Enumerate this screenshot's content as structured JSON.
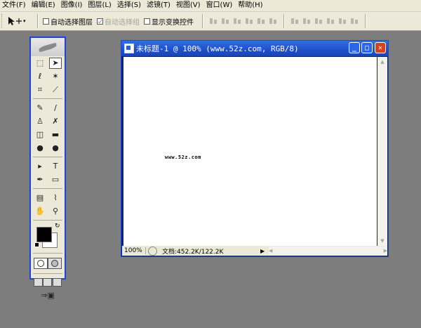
{
  "menu": [
    "文件(F)",
    "编辑(E)",
    "图像(I)",
    "图层(L)",
    "选择(S)",
    "滤镜(T)",
    "视图(V)",
    "窗口(W)",
    "帮助(H)"
  ],
  "options": {
    "auto_select_layer": "自动选择图层",
    "auto_select_group": "自动选择组",
    "show_transform_controls": "显示变换控件"
  },
  "document": {
    "title": "未标题-1 @ 100% (www.52z.com, RGB/8)",
    "canvas_text": "www.52z.com",
    "zoom": "100%",
    "info": "文档:452.2K/122.2K"
  },
  "window_buttons": {
    "minimize": "_",
    "maximize": "□",
    "close": "✕"
  },
  "tools": [
    [
      "⬚",
      "➤"
    ],
    [
      "ℓ",
      "✶"
    ],
    [
      "⌗",
      "⟋"
    ],
    [
      "✎",
      "∕"
    ],
    [
      "♙",
      "✗"
    ],
    [
      "◫",
      "▬"
    ],
    [
      "●",
      "●"
    ],
    [
      "▸",
      "T"
    ],
    [
      "✒",
      "▭"
    ],
    [
      "▤",
      "⌇"
    ],
    [
      "✋",
      "⚲"
    ]
  ],
  "colors": {
    "accent": "#1d45d8",
    "title_bar": "#2f6fe8",
    "close": "#d6411e",
    "workspace": "#7d7d7d"
  }
}
